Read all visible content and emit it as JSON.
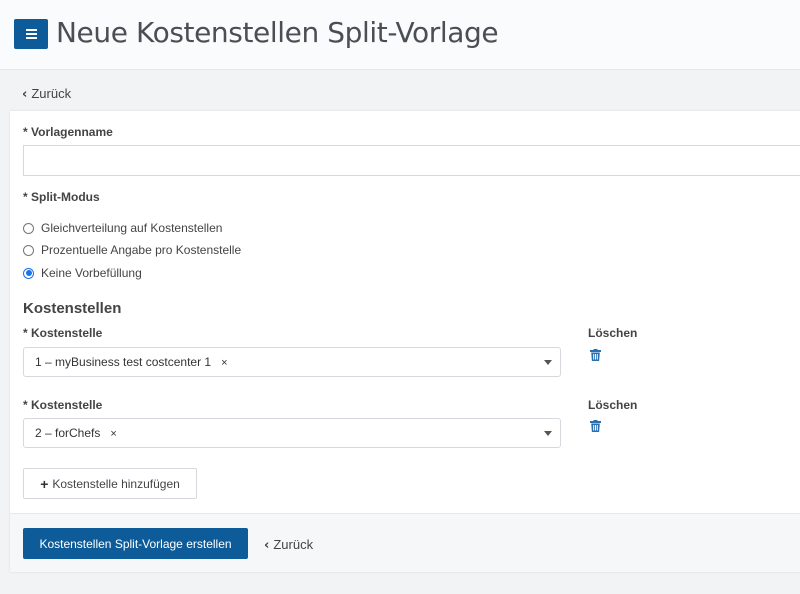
{
  "header": {
    "title": "Neue Kostenstellen Split-Vorlage",
    "menu_icon": "hamburger-menu-icon",
    "accent_color": "#0d5c99"
  },
  "nav": {
    "back_label": "Zurück"
  },
  "form": {
    "template_name": {
      "label": "* Vorlagenname",
      "value": "",
      "placeholder": ""
    },
    "split_mode": {
      "label": "* Split-Modus",
      "options": [
        {
          "label": "Gleichverteilung auf Kostenstellen",
          "selected": false
        },
        {
          "label": "Prozentuelle Angabe pro Kostenstelle",
          "selected": false
        },
        {
          "label": "Keine Vorbefüllung",
          "selected": true
        }
      ]
    },
    "cost_centers": {
      "heading": "Kostenstellen",
      "rows": [
        {
          "label": "* Kostenstelle",
          "value": "1 – myBusiness test costcenter 1",
          "remove_symbol": "×",
          "delete_label": "Löschen",
          "delete_icon": "trash-icon"
        },
        {
          "label": "* Kostenstelle",
          "value": "2 – forChefs",
          "remove_symbol": "×",
          "delete_label": "Löschen",
          "delete_icon": "trash-icon"
        }
      ],
      "add_label": "Kostenstelle hinzufügen",
      "add_icon": "plus-icon"
    }
  },
  "footer": {
    "submit_label": "Kostenstellen Split-Vorlage erstellen",
    "back_label": "Zurück"
  }
}
